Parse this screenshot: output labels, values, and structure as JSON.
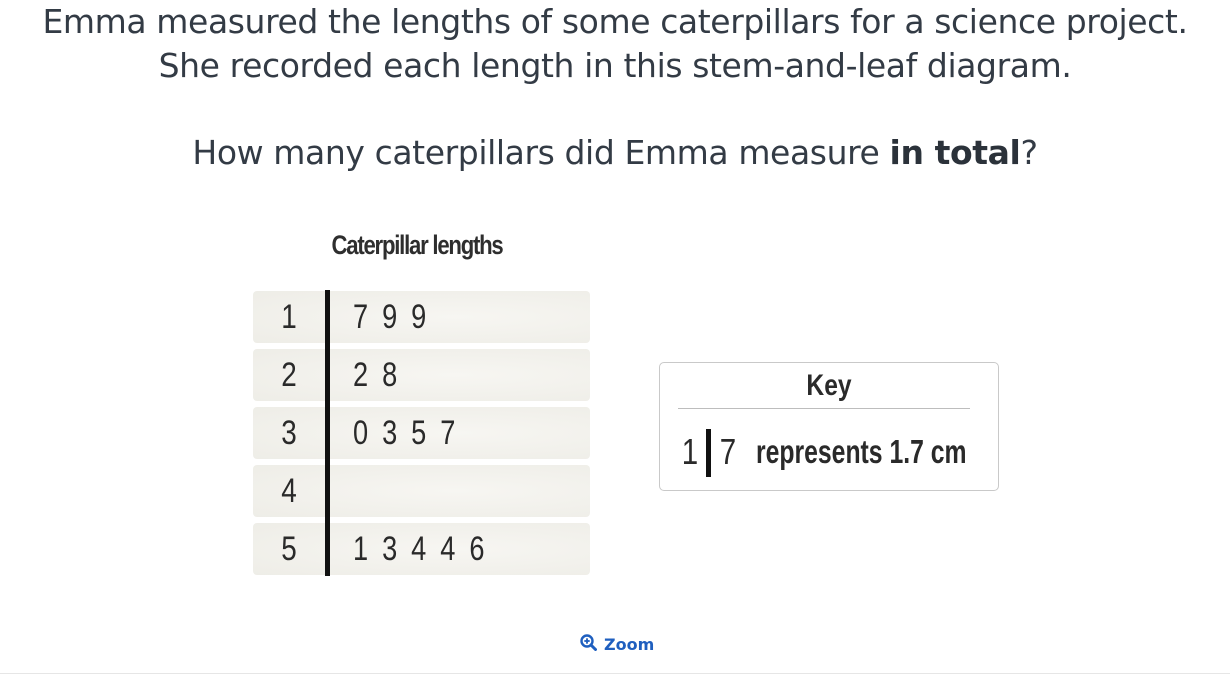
{
  "question": {
    "line1": "Emma measured the lengths of some caterpillars for a science project.",
    "line2": "She recorded each length in this stem-and-leaf diagram.",
    "line3_prefix": "How many caterpillars did Emma measure ",
    "line3_bold": "in total",
    "line3_suffix": "?"
  },
  "plot": {
    "title": "Caterpillar lengths",
    "rows": [
      {
        "stem": "1",
        "leaves": "7 9 9"
      },
      {
        "stem": "2",
        "leaves": "2 8"
      },
      {
        "stem": "3",
        "leaves": "0 3 5 7"
      },
      {
        "stem": "4",
        "leaves": ""
      },
      {
        "stem": "5",
        "leaves": "1 3 4 4 6"
      }
    ]
  },
  "key": {
    "title": "Key",
    "stem": "1",
    "leaf": "7",
    "text": "represents 1.7 cm"
  },
  "zoom": {
    "label": "Zoom",
    "icon": "zoom-in-icon"
  }
}
